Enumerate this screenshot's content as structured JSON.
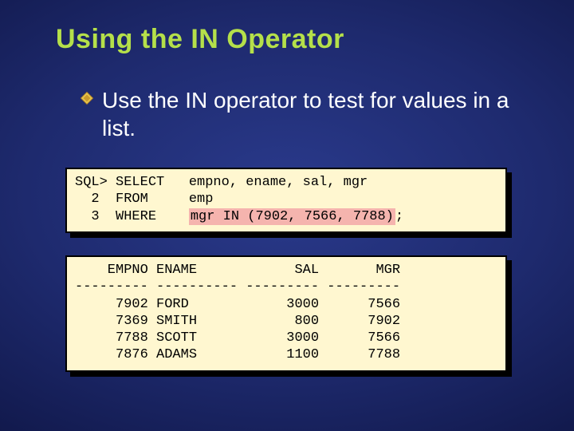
{
  "title": "Using the IN Operator",
  "bullet": "Use the IN operator to test for values in a list.",
  "code": {
    "l1a": "SQL> SELECT   empno, ename, sal, mgr",
    "l2a": "  2  FROM     emp",
    "l3_prefix": "  3  WHERE    ",
    "l3_hl": "mgr IN (7902, 7566, 7788)",
    "l3_suffix": ";"
  },
  "result": {
    "header": "    EMPNO ENAME            SAL       MGR",
    "divider": "--------- ---------- --------- ---------",
    "r1": "     7902 FORD            3000      7566",
    "r2": "     7369 SMITH            800      7902",
    "r3": "     7788 SCOTT           3000      7566",
    "r4": "     7876 ADAMS           1100      7788"
  },
  "chart_data": {
    "type": "table",
    "title": "Result of IN-operator query",
    "columns": [
      "EMPNO",
      "ENAME",
      "SAL",
      "MGR"
    ],
    "rows": [
      {
        "EMPNO": 7902,
        "ENAME": "FORD",
        "SAL": 3000,
        "MGR": 7566
      },
      {
        "EMPNO": 7369,
        "ENAME": "SMITH",
        "SAL": 800,
        "MGR": 7902
      },
      {
        "EMPNO": 7788,
        "ENAME": "SCOTT",
        "SAL": 3000,
        "MGR": 7566
      },
      {
        "EMPNO": 7876,
        "ENAME": "ADAMS",
        "SAL": 1100,
        "MGR": 7788
      }
    ],
    "query": "SELECT empno, ename, sal, mgr FROM emp WHERE mgr IN (7902, 7566, 7788);"
  }
}
